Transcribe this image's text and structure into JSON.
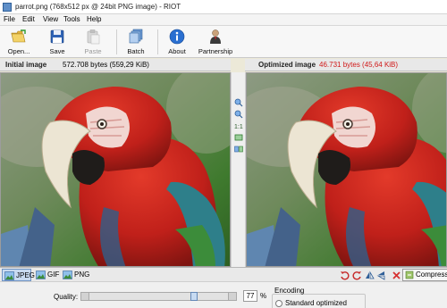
{
  "window": {
    "title": "parrot.png (768x512 px @ 24bit PNG image) - RIOT"
  },
  "menu": [
    "File",
    "Edit",
    "View",
    "Tools",
    "Help"
  ],
  "toolbar": {
    "open_label": "Open...",
    "save_label": "Save",
    "paste_label": "Paste",
    "batch_label": "Batch",
    "about_label": "About",
    "partnership_label": "Partnership"
  },
  "initial": {
    "header": "Initial image",
    "size": "572.708 bytes (559,29 KiB)"
  },
  "optimized": {
    "header": "Optimized image",
    "size": "46.731 bytes (45,64 KiB)",
    "size_color": "#d01818"
  },
  "formats": {
    "jpeg": "JPEG",
    "gif": "GIF",
    "png": "PNG"
  },
  "compress_label": "Compress",
  "quality": {
    "label": "Quality:",
    "value": "77",
    "unit": "%",
    "fraction": 0.77
  },
  "encoding": {
    "title": "Encoding",
    "option": "Standard optimized"
  },
  "icons": {
    "open": "folder-open-icon",
    "save": "floppy-icon",
    "paste": "paste-icon",
    "batch": "batch-icon",
    "about": "info-icon",
    "partnership": "person-icon"
  }
}
